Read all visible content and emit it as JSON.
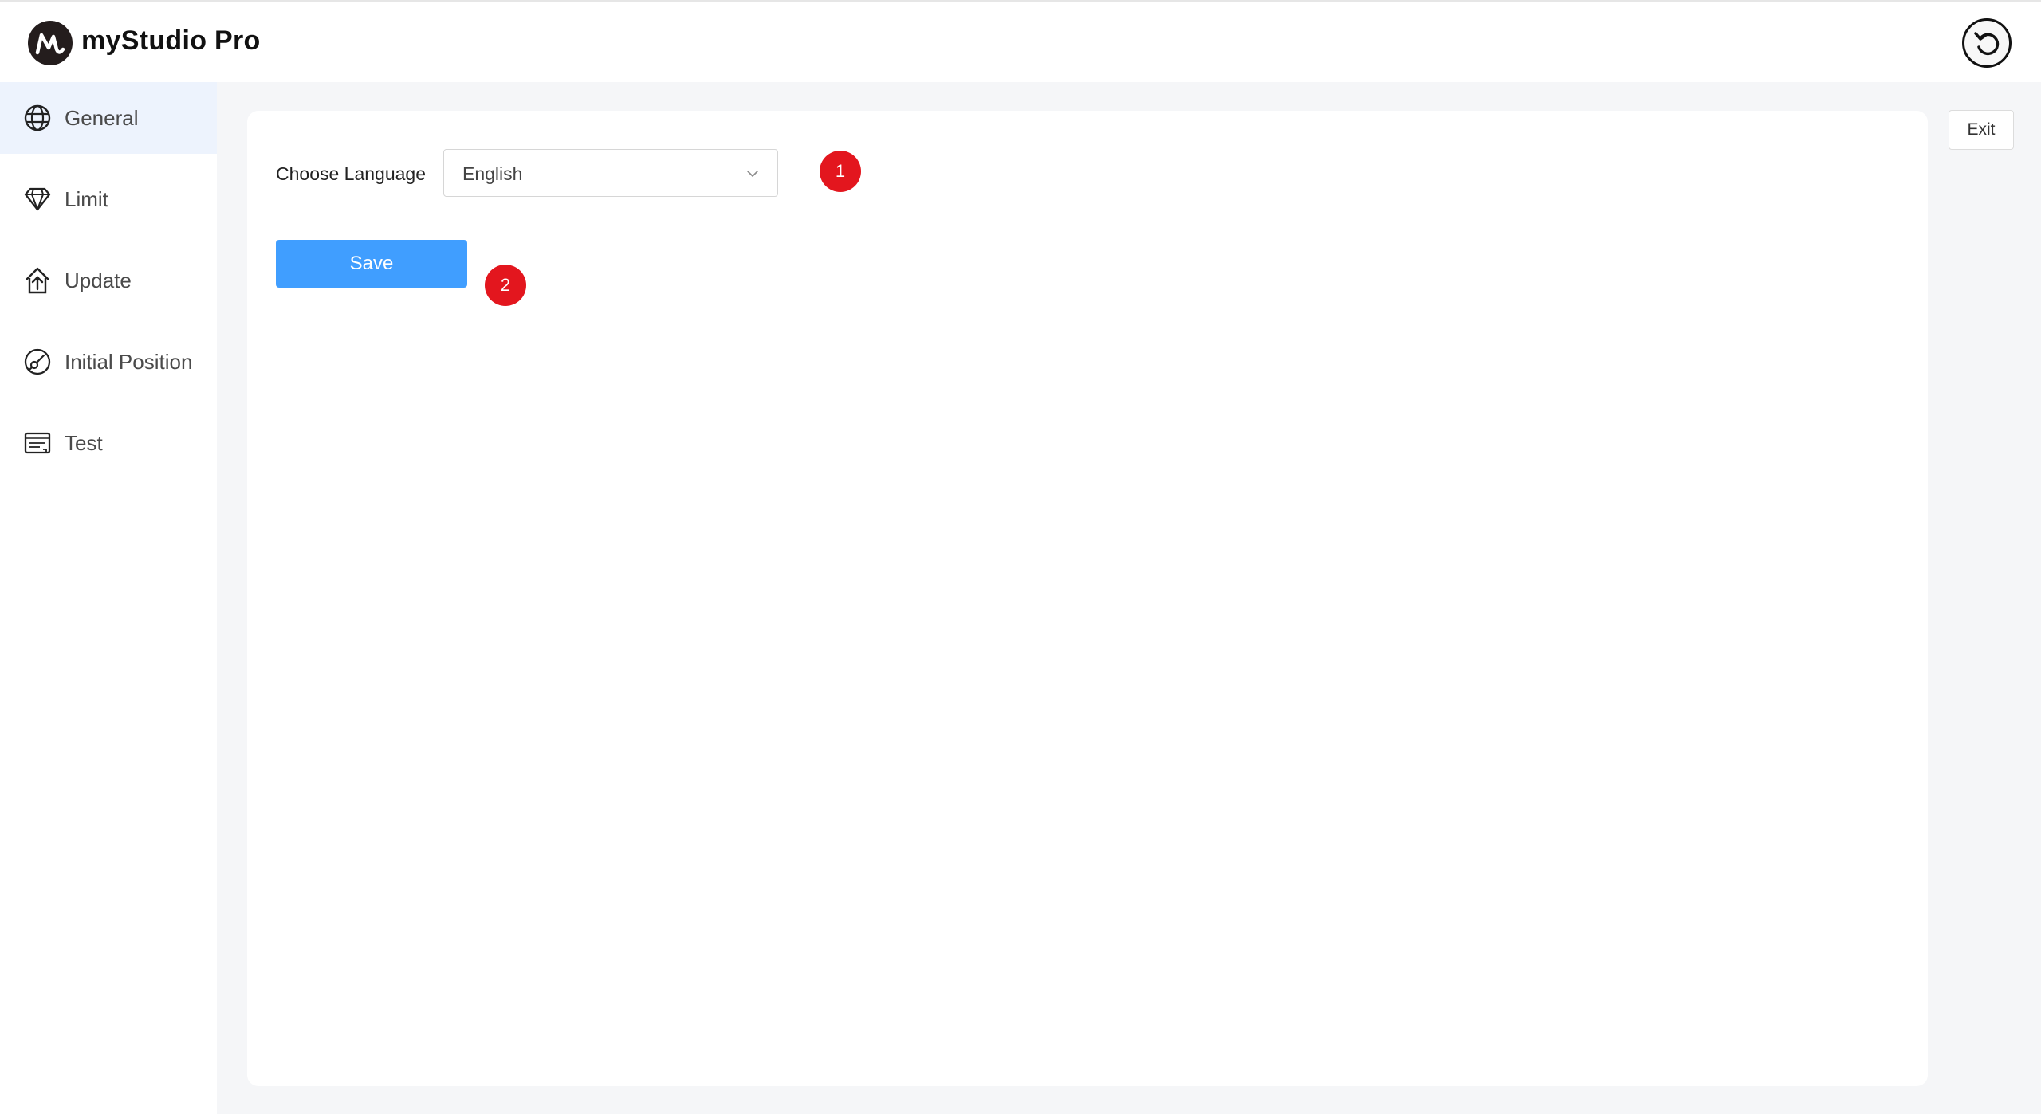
{
  "app": {
    "title": "myStudio Pro"
  },
  "header": {
    "back_icon": "undo-circle-icon"
  },
  "sidebar": {
    "items": [
      {
        "label": "General",
        "icon": "globe-icon",
        "active": true
      },
      {
        "label": "Limit",
        "icon": "diamond-limit-icon",
        "active": false
      },
      {
        "label": "Update",
        "icon": "upload-house-icon",
        "active": false
      },
      {
        "label": "Initial Position",
        "icon": "position-dial-icon",
        "active": false
      },
      {
        "label": "Test",
        "icon": "test-card-icon",
        "active": false
      }
    ]
  },
  "main": {
    "exit_label": "Exit",
    "language": {
      "label": "Choose Language",
      "value": "English"
    },
    "save_label": "Save",
    "annotations": [
      "1",
      "2"
    ]
  },
  "colors": {
    "accent": "#409eff",
    "active_nav_bg": "#edf3fd",
    "badge": "#e3161e",
    "content_bg": "#f5f6f8"
  }
}
